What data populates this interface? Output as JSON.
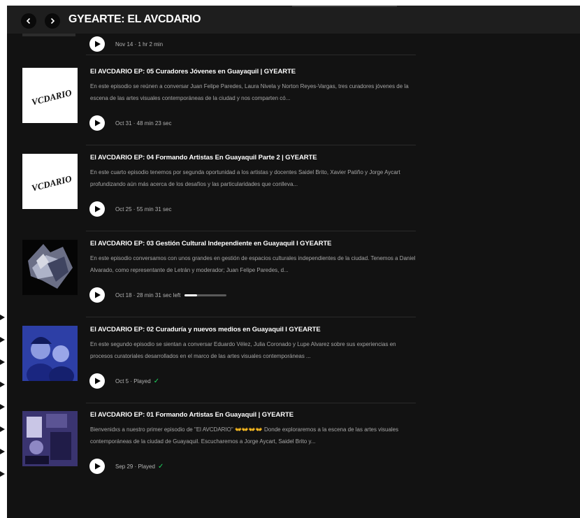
{
  "topbar": {
    "title": "GYEARTE: EL AVCDARIO",
    "back_icon": "chevron-left-icon",
    "forward_icon": "chevron-right-icon"
  },
  "previous_episode": {
    "meta": "Nov 14 · 1 hr 2 min"
  },
  "episodes": [
    {
      "title": "El AVCDARIO EP: 05 Curadores Jóvenes en Guayaquil | GYEARTE",
      "description": "En este episodio se reúnen a conversar Juan Felipe Paredes, Laura Nivela y Norton Reyes-Vargas, tres curadores jóvenes de la escena de las artes visuales contemporáneas de la ciudad y nos comparten có...",
      "meta": "Oct 31 · 48 min 23 sec",
      "thumb_logo": "VCDARIO"
    },
    {
      "title": "El AVCDARIO EP: 04 Formando Artistas En Guayaquil Parte 2 | GYEARTE",
      "description": "En este cuarto episodio tenemos por segunda oportunidad a los artistas y docentes Saidel Brito, Xavier Patiño y Jorge Aycart profundizando aún más acerca de los desafíos y las particularidades que conlleva...",
      "meta": "Oct 25 · 55 min 31 sec",
      "thumb_logo": "VCDARIO"
    },
    {
      "title": "El AVCDARIO EP: 03 Gestión Cultural Independiente en Guayaquil I GYEARTE",
      "description": "En este episodio conversamos con unos grandes en gestión de espacios culturales independientes de la ciudad. Tenemos a Daniel Alvarado, como representante de Letrán y moderador; Juan Felipe Paredes, d...",
      "meta": "Oct 18 · 28 min 31 sec left",
      "progress": 0.3
    },
    {
      "title": "El AVCDARIO EP: 02 Curaduría y nuevos medios en Guayaquil I GYEARTE",
      "description": "En este segundo episodio se sientan a conversar Eduardo Vélez, Julia Coronado y Lupe Alvarez sobre sus experiencias en procesos curatoriales desarrollados en el marco de las artes visuales contemporáneas ...",
      "meta": "Oct 5 · Played",
      "played": true
    },
    {
      "title": "El AVCDARIO EP: 01 Formando Artistas En Guayaquil | GYEARTE",
      "description": "Bienvenidxs a nuestro primer episodio de \"El AVCDARIO\" 👐👐👐👐 Donde exploraremos a la escena de las artes visuales contemporáneas de la ciudad de Guayaquil. Escucharemos a Jorge Aycart, Saidel Brito y...",
      "meta": "Sep 29 · Played",
      "played": true
    }
  ],
  "colors": {
    "background": "#121212",
    "topbar": "#1e1e1e",
    "played_check": "#1ed760",
    "text_muted": "#a7a7a7"
  }
}
